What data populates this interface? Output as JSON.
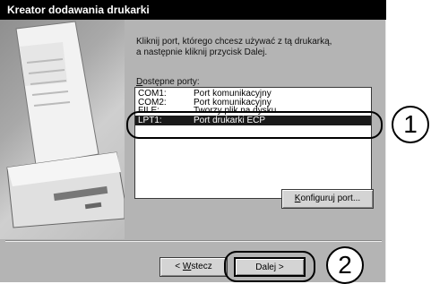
{
  "window": {
    "title": "Kreator dodawania drukarki"
  },
  "instruction": {
    "line1": "Kliknij port, którego chcesz używać z tą drukarką,",
    "line2": "a następnie kliknij przycisk Dalej."
  },
  "ports": {
    "label_hotkey": "D",
    "label_rest": "ostępne porty:",
    "rows": [
      {
        "port": "COM1:",
        "desc": "Port komunikacyjny",
        "selected": false
      },
      {
        "port": "COM2:",
        "desc": "Port komunikacyjny",
        "selected": false
      },
      {
        "port": "FILE:",
        "desc": "Tworzy plik na dysku",
        "selected": false
      },
      {
        "port": "LPT1:",
        "desc": "Port drukarki ECP",
        "selected": true
      }
    ]
  },
  "buttons": {
    "configure_hotkey": "K",
    "configure_rest": "onfiguruj port...",
    "back_prefix": "< ",
    "back_hotkey": "W",
    "back_rest": "stecz",
    "next_label": "Dalej >"
  },
  "callouts": {
    "one": "1",
    "two": "2"
  }
}
